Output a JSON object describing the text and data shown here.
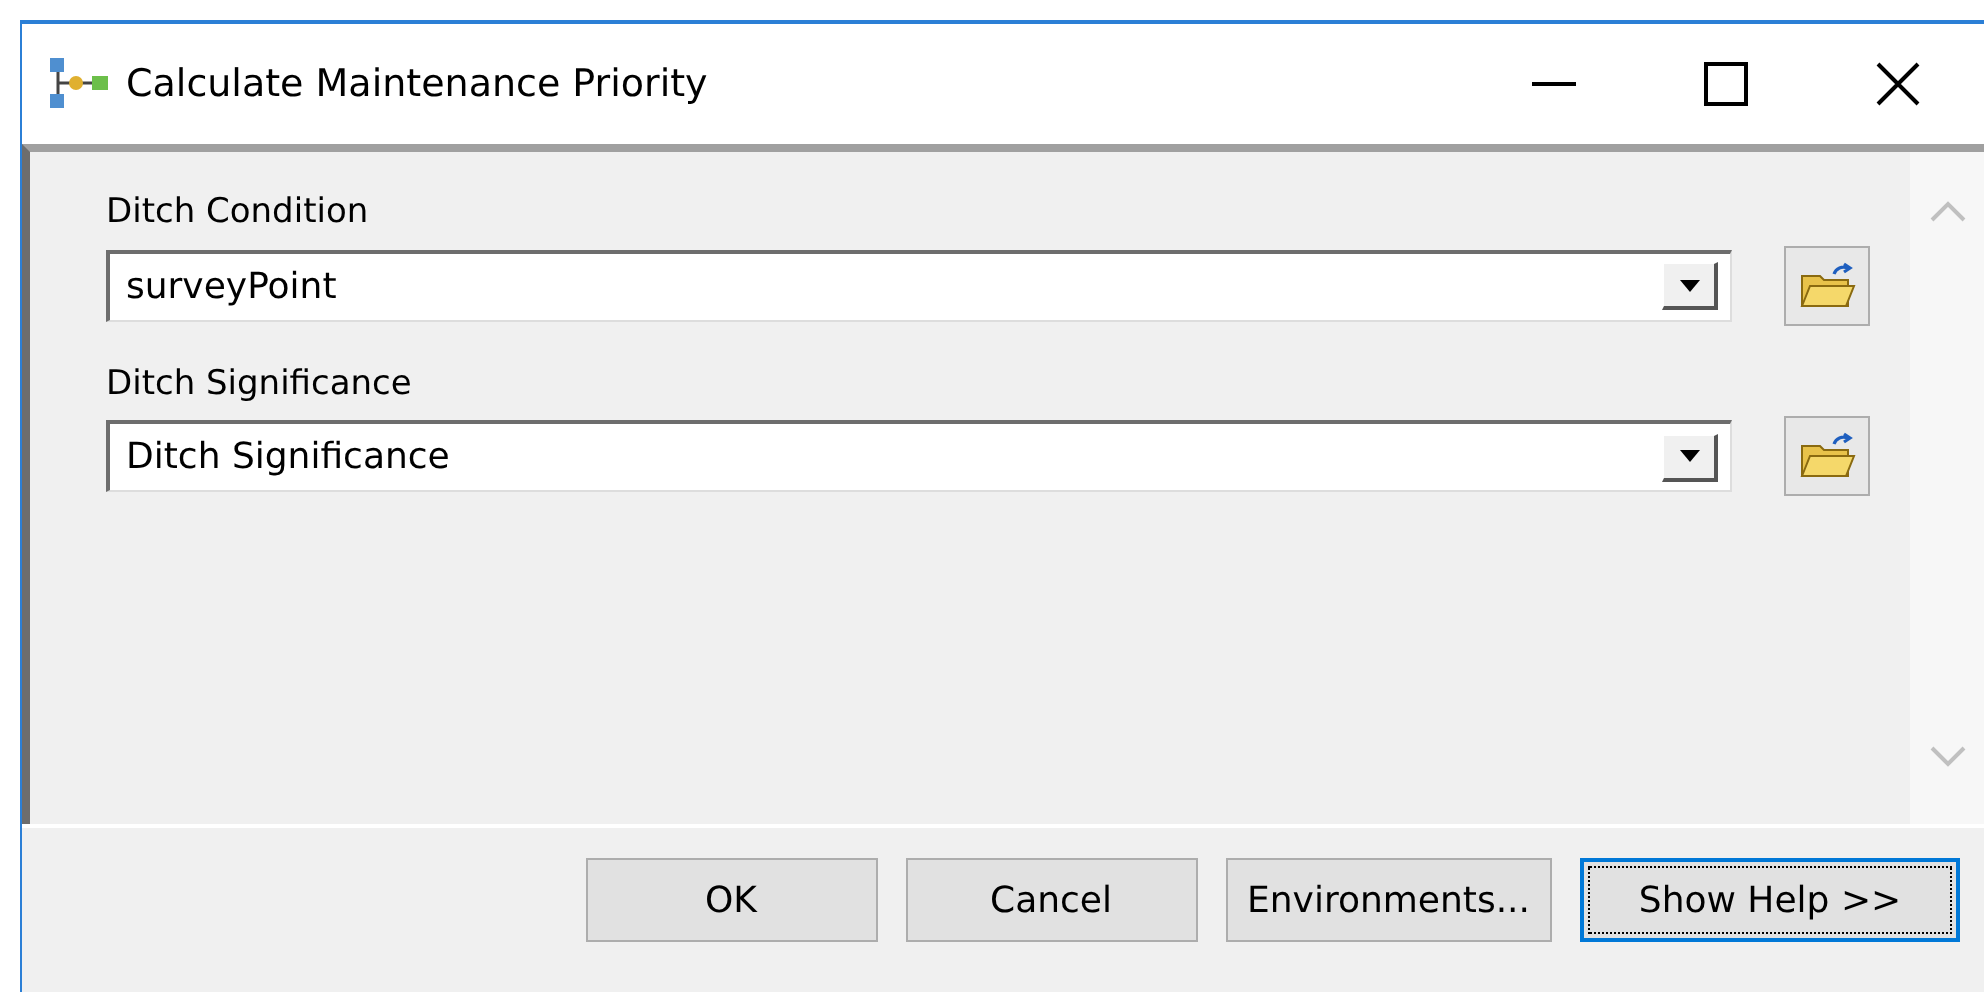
{
  "window": {
    "title": "Calculate Maintenance Priority"
  },
  "parameters": [
    {
      "label": "Ditch Condition",
      "value": "surveyPoint"
    },
    {
      "label": "Ditch Significance",
      "value": "Ditch Significance"
    }
  ],
  "buttons": [
    {
      "label": "OK",
      "focused": false
    },
    {
      "label": "Cancel",
      "focused": false
    },
    {
      "label": "Environments...",
      "focused": false
    },
    {
      "label": "Show Help >>",
      "focused": true
    }
  ]
}
